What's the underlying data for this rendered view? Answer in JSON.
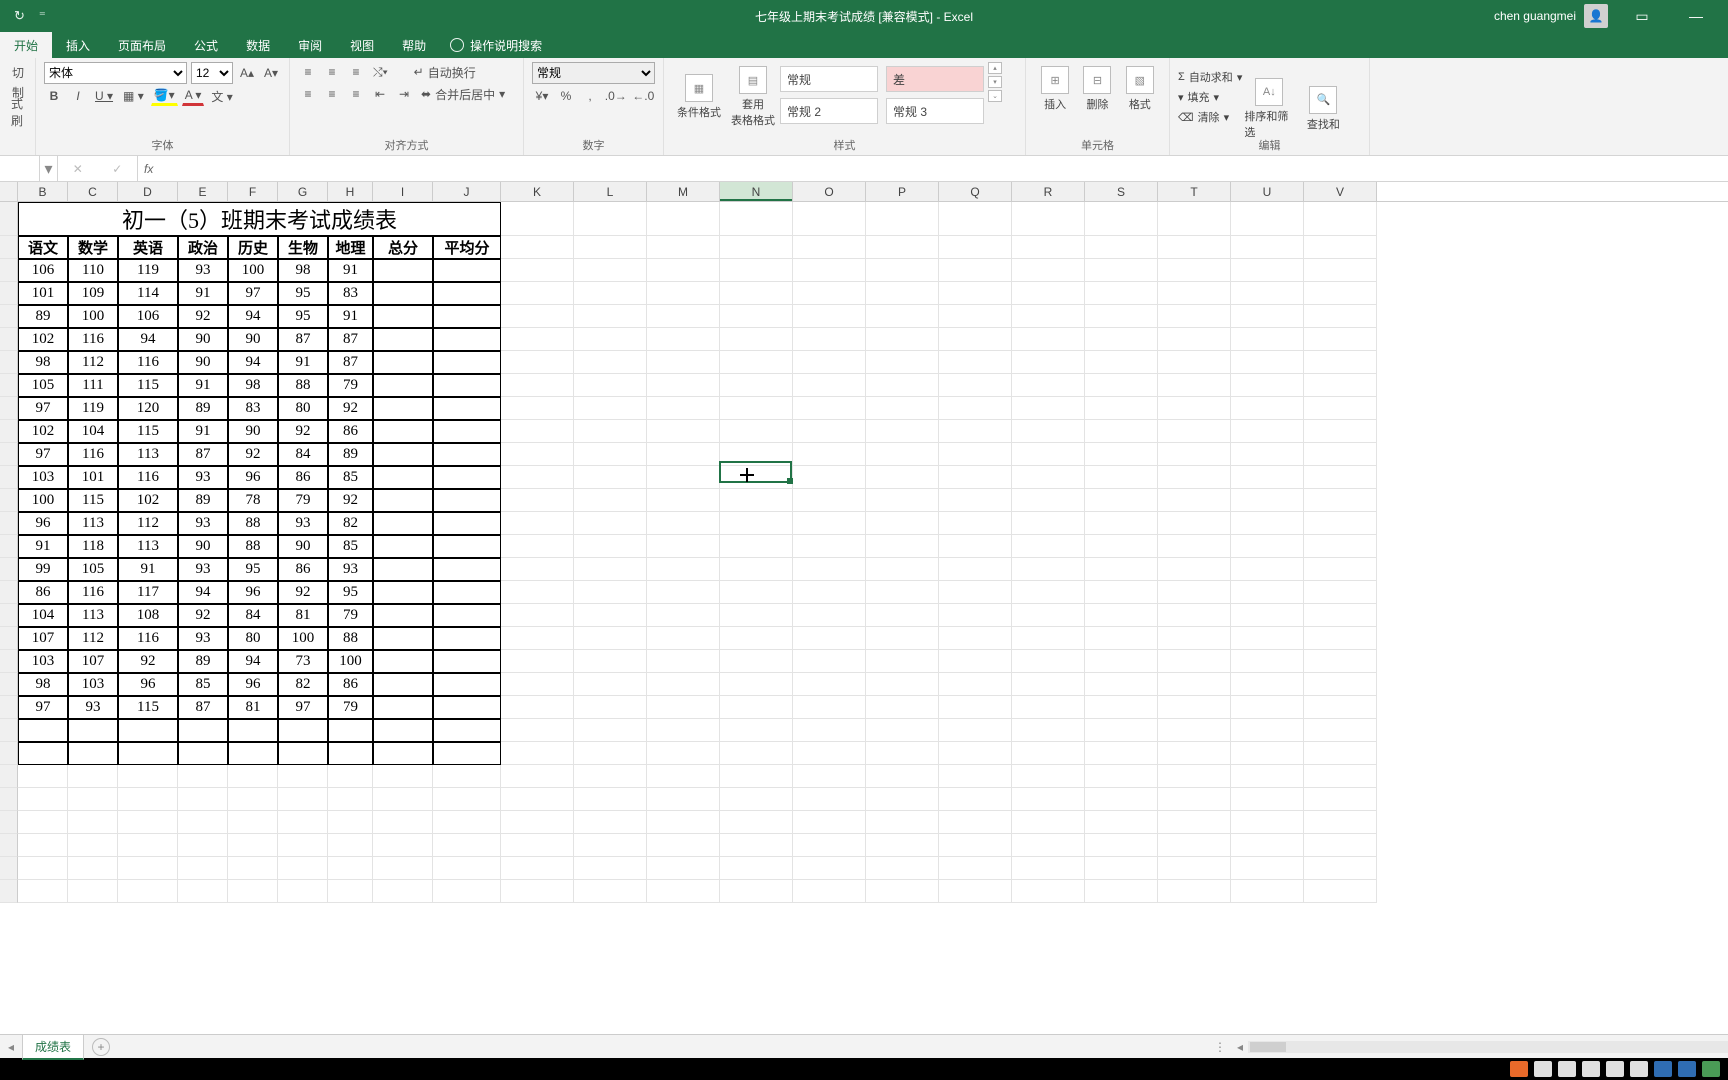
{
  "title": "七年级上期末考试成绩 [兼容模式] - Excel",
  "user": "chen guangmei",
  "tabs": [
    "开始",
    "插入",
    "页面布局",
    "公式",
    "数据",
    "审阅",
    "视图",
    "帮助"
  ],
  "search_hint": "操作说明搜索",
  "ribbon": {
    "clipboard": {
      "cut": "切",
      "copy": "制",
      "brush": "式刷"
    },
    "font": {
      "name": "宋体",
      "size": "12",
      "group": "字体"
    },
    "align": {
      "wrap": "自动换行",
      "merge": "合并后居中",
      "group": "对齐方式"
    },
    "number": {
      "fmt": "常规",
      "group": "数字"
    },
    "cond": {
      "a": "条件格式",
      "b": "套用\n表格格式"
    },
    "styles": {
      "s1": "常规",
      "s2": "差",
      "s3": "常规 2",
      "s4": "常规 3",
      "group": "样式"
    },
    "cells": {
      "ins": "插入",
      "del": "删除",
      "fmt": "格式",
      "group": "单元格"
    },
    "edit": {
      "sum": "自动求和",
      "fill": "填充",
      "clear": "清除",
      "sort": "排序和筛选",
      "find": "查找和",
      "group": "编辑"
    }
  },
  "fx": "fx",
  "name_cell": "",
  "cols": [
    "B",
    "C",
    "D",
    "E",
    "F",
    "G",
    "H",
    "I",
    "J",
    "K",
    "L",
    "M",
    "N",
    "O",
    "P",
    "Q",
    "R",
    "S",
    "T",
    "U",
    "V"
  ],
  "title_cell": "初一（5）班期末考试成绩表",
  "headers": [
    "语文",
    "数学",
    "英语",
    "政治",
    "历史",
    "生物",
    "地理",
    "总分",
    "平均分"
  ],
  "rows": [
    [
      106,
      110,
      119,
      93,
      100,
      98,
      91
    ],
    [
      101,
      109,
      114,
      91,
      97,
      95,
      83
    ],
    [
      89,
      100,
      106,
      92,
      94,
      95,
      91
    ],
    [
      102,
      116,
      94,
      90,
      90,
      87,
      87
    ],
    [
      98,
      112,
      116,
      90,
      94,
      91,
      87
    ],
    [
      105,
      111,
      115,
      91,
      98,
      88,
      79
    ],
    [
      97,
      119,
      120,
      89,
      83,
      80,
      92
    ],
    [
      102,
      104,
      115,
      91,
      90,
      92,
      86
    ],
    [
      97,
      116,
      113,
      87,
      92,
      84,
      89
    ],
    [
      103,
      101,
      116,
      93,
      96,
      86,
      85
    ],
    [
      100,
      115,
      102,
      89,
      78,
      79,
      92
    ],
    [
      96,
      113,
      112,
      93,
      88,
      93,
      82
    ],
    [
      91,
      118,
      113,
      90,
      88,
      90,
      85
    ],
    [
      99,
      105,
      91,
      93,
      95,
      86,
      93
    ],
    [
      86,
      116,
      117,
      94,
      96,
      92,
      95
    ],
    [
      104,
      113,
      108,
      92,
      84,
      81,
      79
    ],
    [
      107,
      112,
      116,
      93,
      80,
      100,
      88
    ],
    [
      103,
      107,
      92,
      89,
      94,
      73,
      100
    ],
    [
      98,
      103,
      96,
      85,
      96,
      82,
      86
    ],
    [
      97,
      93,
      115,
      87,
      81,
      97,
      79
    ]
  ],
  "sheet_tab": "成绩表",
  "chart_data": {
    "type": "table",
    "title": "初一（5）班期末考试成绩表",
    "columns": [
      "语文",
      "数学",
      "英语",
      "政治",
      "历史",
      "生物",
      "地理",
      "总分",
      "平均分"
    ],
    "data": [
      [
        106,
        110,
        119,
        93,
        100,
        98,
        91,
        null,
        null
      ],
      [
        101,
        109,
        114,
        91,
        97,
        95,
        83,
        null,
        null
      ],
      [
        89,
        100,
        106,
        92,
        94,
        95,
        91,
        null,
        null
      ],
      [
        102,
        116,
        94,
        90,
        90,
        87,
        87,
        null,
        null
      ],
      [
        98,
        112,
        116,
        90,
        94,
        91,
        87,
        null,
        null
      ],
      [
        105,
        111,
        115,
        91,
        98,
        88,
        79,
        null,
        null
      ],
      [
        97,
        119,
        120,
        89,
        83,
        80,
        92,
        null,
        null
      ],
      [
        102,
        104,
        115,
        91,
        90,
        92,
        86,
        null,
        null
      ],
      [
        97,
        116,
        113,
        87,
        92,
        84,
        89,
        null,
        null
      ],
      [
        103,
        101,
        116,
        93,
        96,
        86,
        85,
        null,
        null
      ],
      [
        100,
        115,
        102,
        89,
        78,
        79,
        92,
        null,
        null
      ],
      [
        96,
        113,
        112,
        93,
        88,
        93,
        82,
        null,
        null
      ],
      [
        91,
        118,
        113,
        90,
        88,
        90,
        85,
        null,
        null
      ],
      [
        99,
        105,
        91,
        93,
        95,
        86,
        93,
        null,
        null
      ],
      [
        86,
        116,
        117,
        94,
        96,
        92,
        95,
        null,
        null
      ],
      [
        104,
        113,
        108,
        92,
        84,
        81,
        79,
        null,
        null
      ],
      [
        107,
        112,
        116,
        93,
        80,
        100,
        88,
        null,
        null
      ],
      [
        103,
        107,
        92,
        89,
        94,
        73,
        100,
        null,
        null
      ],
      [
        98,
        103,
        96,
        85,
        96,
        82,
        86,
        null,
        null
      ],
      [
        97,
        93,
        115,
        87,
        81,
        97,
        79,
        null,
        null
      ]
    ]
  }
}
